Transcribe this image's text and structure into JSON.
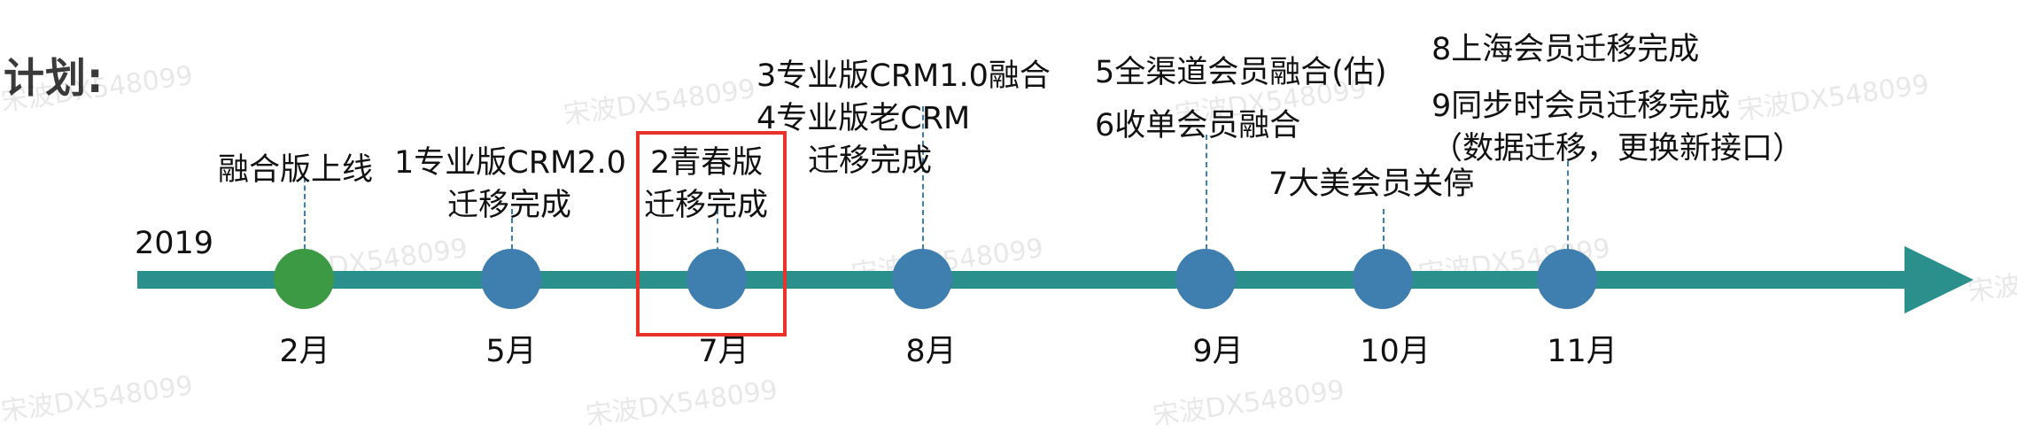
{
  "title": "计划:",
  "year": "2019",
  "colors": {
    "axis": "#2b8f8b",
    "node": "#3f7fb0",
    "node_first": "#3d9a44",
    "highlight": "#e8332a"
  },
  "months": [
    "2月",
    "5月",
    "7月",
    "8月",
    "9月",
    "10月",
    "11月"
  ],
  "labels": {
    "m2": "融合版上线",
    "m5": [
      "1专业版CRM2.0",
      "迁移完成"
    ],
    "m7": [
      "2青春版",
      "迁移完成"
    ],
    "m8": [
      "3专业版CRM1.0融合",
      "4专业版老CRM",
      "迁移完成"
    ],
    "m9": [
      "5全渠道会员融合(估)",
      "6收单会员融合"
    ],
    "m10": "7大美会员关停",
    "m11": [
      "8上海会员迁移完成",
      "9同步时会员迁移完成",
      "（数据迁移，更换新接口）"
    ]
  },
  "watermark": "宋波DX548099"
}
